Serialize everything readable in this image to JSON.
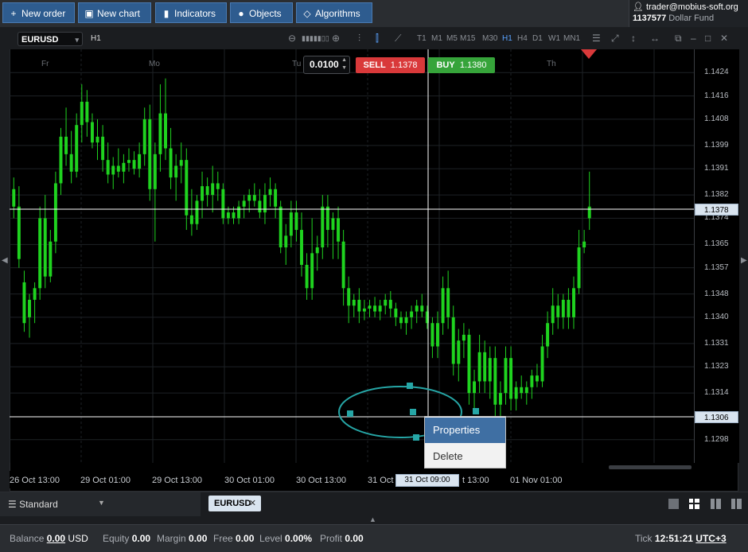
{
  "toolbar": {
    "new_order": "New order",
    "new_chart": "New chart",
    "indicators": "Indicators",
    "objects": "Objects",
    "algorithms": "Algorithms"
  },
  "account": {
    "email": "trader@mobius-soft.org",
    "number": "1137577",
    "fund": "Dollar Fund"
  },
  "chart": {
    "symbol": "EURUSD",
    "timeframe": "H1",
    "timeframes": [
      "T1",
      "M1",
      "M5",
      "M15",
      "M30",
      "H1",
      "H4",
      "D1",
      "W1",
      "MN1"
    ],
    "active_timeframe": "H1",
    "lot": "0.0100",
    "sell_label": "SELL",
    "sell_price": "1.1378",
    "buy_label": "BUY",
    "buy_price": "1.1380",
    "current_price_badge": "1.1378",
    "hline_price_badge": "1.1306",
    "crosshair_time": "31 Oct 09:00",
    "day_labels": [
      "Fr",
      "Mo",
      "Tu",
      "Th"
    ],
    "price_ticks": [
      "1.1424",
      "1.1416",
      "1.1408",
      "1.1399",
      "1.1391",
      "1.1382",
      "1.1374",
      "1.1365",
      "1.1357",
      "1.1348",
      "1.1340",
      "1.1331",
      "1.1323",
      "1.1314",
      "1.1298"
    ],
    "time_ticks": [
      "26 Oct 13:00",
      "29 Oct 01:00",
      "29 Oct 13:00",
      "30 Oct 01:00",
      "30 Oct 13:00",
      "31 Oct",
      "t 13:00",
      "01 Nov 01:00"
    ],
    "colors": {
      "bull": "#1fd31f",
      "bear": "#1fd31f",
      "background": "#000000",
      "ellipse": "#26a6a6"
    }
  },
  "context_menu": {
    "properties": "Properties",
    "delete": "Delete"
  },
  "bottom": {
    "layout_select": "Standard",
    "chart_tab": "EURUSD"
  },
  "status": {
    "balance_label": "Balance",
    "balance": "0.00",
    "currency": "USD",
    "equity_label": "Equity",
    "equity": "0.00",
    "margin_label": "Margin",
    "margin": "0.00",
    "free_label": "Free",
    "free": "0.00",
    "level_label": "Level",
    "level": "0.00%",
    "profit_label": "Profit",
    "profit": "0.00",
    "tick_label": "Tick",
    "tick_time": "12:51:21",
    "timezone": "UTC+3"
  },
  "chart_data": {
    "type": "candlestick",
    "ylim": [
      1.129,
      1.1432
    ],
    "candles": [
      [
        1.1378,
        1.1388,
        1.1374,
        1.1384
      ],
      [
        1.1378,
        1.1385,
        1.1357,
        1.136
      ],
      [
        1.1352,
        1.1356,
        1.1335,
        1.1338
      ],
      [
        1.134,
        1.1348,
        1.1333,
        1.1346
      ],
      [
        1.1346,
        1.1352,
        1.1338,
        1.135
      ],
      [
        1.135,
        1.1378,
        1.1346,
        1.1374
      ],
      [
        1.1374,
        1.1382,
        1.135,
        1.1354
      ],
      [
        1.1354,
        1.137,
        1.1352,
        1.1366
      ],
      [
        1.1366,
        1.139,
        1.1362,
        1.1386
      ],
      [
        1.1386,
        1.1405,
        1.1382,
        1.1402
      ],
      [
        1.1402,
        1.1412,
        1.1392,
        1.1396
      ],
      [
        1.1396,
        1.1404,
        1.1386,
        1.139
      ],
      [
        1.139,
        1.141,
        1.1388,
        1.1406
      ],
      [
        1.1406,
        1.142,
        1.14,
        1.1414
      ],
      [
        1.1414,
        1.1418,
        1.1402,
        1.1407
      ],
      [
        1.1407,
        1.141,
        1.1398,
        1.14
      ],
      [
        1.14,
        1.1408,
        1.1394,
        1.1402
      ],
      [
        1.1402,
        1.1406,
        1.139,
        1.1394
      ],
      [
        1.1394,
        1.14,
        1.1386,
        1.1389
      ],
      [
        1.1389,
        1.1395,
        1.1384,
        1.1392
      ],
      [
        1.1392,
        1.1398,
        1.1388,
        1.139
      ],
      [
        1.139,
        1.1396,
        1.1386,
        1.1393
      ],
      [
        1.1393,
        1.1398,
        1.139,
        1.1394
      ],
      [
        1.1394,
        1.1397,
        1.1389,
        1.1391
      ],
      [
        1.1391,
        1.14,
        1.1388,
        1.1396
      ],
      [
        1.1396,
        1.1412,
        1.1392,
        1.1408
      ],
      [
        1.1408,
        1.1413,
        1.138,
        1.1384
      ],
      [
        1.1384,
        1.14,
        1.1366,
        1.1396
      ],
      [
        1.1396,
        1.142,
        1.139,
        1.141
      ],
      [
        1.141,
        1.1422,
        1.1394,
        1.1398
      ],
      [
        1.1398,
        1.1405,
        1.1384,
        1.1388
      ],
      [
        1.1388,
        1.1396,
        1.138,
        1.1392
      ],
      [
        1.1392,
        1.14,
        1.1386,
        1.1394
      ],
      [
        1.1394,
        1.1398,
        1.137,
        1.1375
      ],
      [
        1.1375,
        1.1384,
        1.1368,
        1.1372
      ],
      [
        1.1372,
        1.1382,
        1.137,
        1.138
      ],
      [
        1.138,
        1.139,
        1.1374,
        1.1385
      ],
      [
        1.1385,
        1.1388,
        1.1378,
        1.1382
      ],
      [
        1.1382,
        1.1392,
        1.1376,
        1.1386
      ],
      [
        1.1386,
        1.139,
        1.138,
        1.1384
      ],
      [
        1.1384,
        1.1386,
        1.1372,
        1.1374
      ],
      [
        1.1374,
        1.1378,
        1.1372,
        1.1376
      ],
      [
        1.1376,
        1.1378,
        1.1372,
        1.1374
      ],
      [
        1.1374,
        1.138,
        1.1372,
        1.1378
      ],
      [
        1.1378,
        1.1382,
        1.1374,
        1.138
      ],
      [
        1.138,
        1.1384,
        1.1376,
        1.1382
      ],
      [
        1.1382,
        1.1386,
        1.1378,
        1.138
      ],
      [
        1.138,
        1.1384,
        1.1374,
        1.1376
      ],
      [
        1.1376,
        1.1386,
        1.1372,
        1.1382
      ],
      [
        1.1382,
        1.1388,
        1.1378,
        1.1384
      ],
      [
        1.1384,
        1.1386,
        1.1374,
        1.1378
      ],
      [
        1.1378,
        1.138,
        1.1362,
        1.1364
      ],
      [
        1.1364,
        1.1372,
        1.1358,
        1.1368
      ],
      [
        1.1368,
        1.138,
        1.1364,
        1.1376
      ],
      [
        1.1376,
        1.138,
        1.1366,
        1.137
      ],
      [
        1.137,
        1.1376,
        1.1354,
        1.1358
      ],
      [
        1.1358,
        1.1362,
        1.1346,
        1.135
      ],
      [
        1.135,
        1.1374,
        1.1346,
        1.1362
      ],
      [
        1.1362,
        1.1368,
        1.1356,
        1.1364
      ],
      [
        1.1364,
        1.1382,
        1.136,
        1.1378
      ],
      [
        1.1378,
        1.1382,
        1.1364,
        1.137
      ],
      [
        1.137,
        1.1376,
        1.136,
        1.1374
      ],
      [
        1.1374,
        1.1378,
        1.136,
        1.1366
      ],
      [
        1.1366,
        1.137,
        1.1344,
        1.135
      ],
      [
        1.135,
        1.1354,
        1.1338,
        1.1344
      ],
      [
        1.1344,
        1.1348,
        1.134,
        1.1346
      ],
      [
        1.1346,
        1.135,
        1.1338,
        1.1342
      ],
      [
        1.1342,
        1.1346,
        1.1339,
        1.1343
      ],
      [
        1.1343,
        1.1346,
        1.134,
        1.1344
      ],
      [
        1.1344,
        1.1347,
        1.134,
        1.1342
      ],
      [
        1.1342,
        1.1346,
        1.1339,
        1.1344
      ],
      [
        1.1344,
        1.1348,
        1.1341,
        1.1346
      ],
      [
        1.1346,
        1.1349,
        1.134,
        1.1343
      ],
      [
        1.1343,
        1.1345,
        1.1337,
        1.134
      ],
      [
        1.134,
        1.1342,
        1.1336,
        1.1338
      ],
      [
        1.1338,
        1.1342,
        1.1334,
        1.134
      ],
      [
        1.134,
        1.1344,
        1.1336,
        1.1342
      ],
      [
        1.1342,
        1.1346,
        1.1338,
        1.1344
      ],
      [
        1.1344,
        1.1348,
        1.134,
        1.1342
      ],
      [
        1.1342,
        1.1344,
        1.1336,
        1.1338
      ],
      [
        1.1338,
        1.134,
        1.1326,
        1.133
      ],
      [
        1.133,
        1.1342,
        1.1326,
        1.1338
      ],
      [
        1.1338,
        1.1354,
        1.1334,
        1.135
      ],
      [
        1.135,
        1.1356,
        1.1336,
        1.134
      ],
      [
        1.134,
        1.1344,
        1.132,
        1.1324
      ],
      [
        1.1324,
        1.1336,
        1.1318,
        1.1332
      ],
      [
        1.1332,
        1.1338,
        1.1326,
        1.1334
      ],
      [
        1.1334,
        1.1336,
        1.131,
        1.1314
      ],
      [
        1.1314,
        1.1322,
        1.1308,
        1.1318
      ],
      [
        1.1318,
        1.1334,
        1.1314,
        1.1328
      ],
      [
        1.1328,
        1.1332,
        1.1314,
        1.1318
      ],
      [
        1.1318,
        1.133,
        1.1312,
        1.1326
      ],
      [
        1.1326,
        1.133,
        1.1306,
        1.131
      ],
      [
        1.131,
        1.1318,
        1.1306,
        1.1314
      ],
      [
        1.1314,
        1.133,
        1.131,
        1.1326
      ],
      [
        1.1326,
        1.133,
        1.1308,
        1.1312
      ],
      [
        1.1312,
        1.1318,
        1.1308,
        1.1316
      ],
      [
        1.1316,
        1.132,
        1.1312,
        1.1314
      ],
      [
        1.1314,
        1.1318,
        1.131,
        1.1316
      ],
      [
        1.1316,
        1.1322,
        1.1312,
        1.132
      ],
      [
        1.132,
        1.1324,
        1.1316,
        1.1318
      ],
      [
        1.1318,
        1.1334,
        1.1316,
        1.133
      ],
      [
        1.133,
        1.1342,
        1.1326,
        1.1338
      ],
      [
        1.1338,
        1.135,
        1.1334,
        1.1344
      ],
      [
        1.1344,
        1.1348,
        1.1336,
        1.134
      ],
      [
        1.134,
        1.1348,
        1.1336,
        1.1346
      ],
      [
        1.1346,
        1.135,
        1.1336,
        1.134
      ],
      [
        1.134,
        1.1354,
        1.1336,
        1.135
      ],
      [
        1.135,
        1.137,
        1.1348,
        1.1364
      ],
      [
        1.1364,
        1.137,
        1.1362,
        1.1366
      ],
      [
        1.1374,
        1.139,
        1.137,
        1.1378
      ]
    ]
  }
}
